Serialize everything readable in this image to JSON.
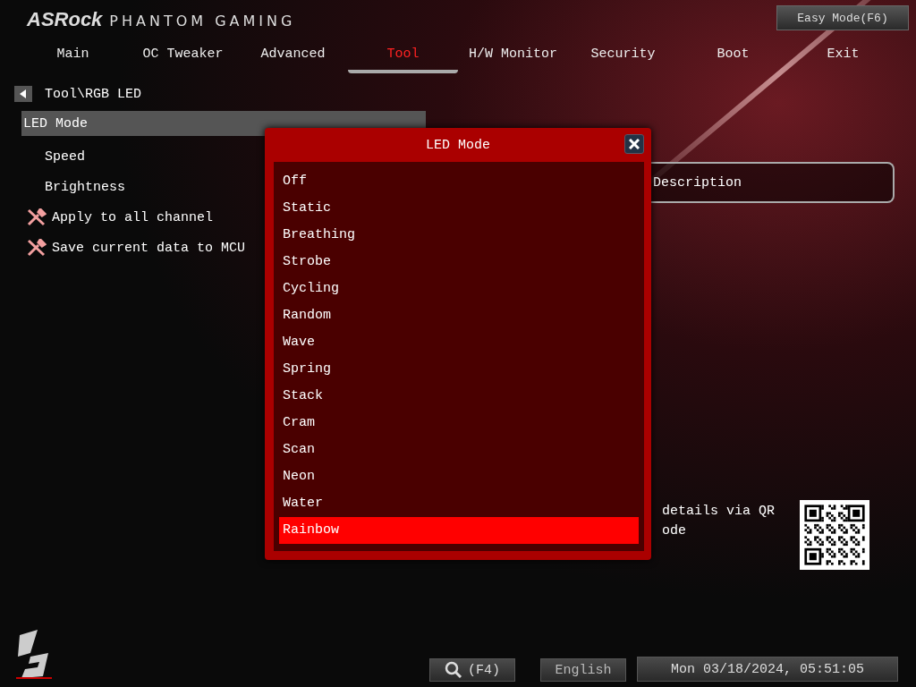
{
  "header": {
    "brand": "ASRock",
    "product": "PHANTOM GAMING",
    "easy_mode_button": "Easy Mode(F6)"
  },
  "tabs": [
    {
      "label": "Main",
      "selected": false
    },
    {
      "label": "OC Tweaker",
      "selected": false
    },
    {
      "label": "Advanced",
      "selected": false
    },
    {
      "label": "Tool",
      "selected": true
    },
    {
      "label": "H/W Monitor",
      "selected": false
    },
    {
      "label": "Security",
      "selected": false
    },
    {
      "label": "Boot",
      "selected": false
    },
    {
      "label": "Exit",
      "selected": false
    }
  ],
  "breadcrumb": "Tool\\RGB LED",
  "menu": [
    {
      "label": "LED Mode",
      "kind": "setting",
      "selected": true
    },
    {
      "label": "Speed",
      "kind": "setting",
      "selected": false
    },
    {
      "label": "Brightness",
      "kind": "setting",
      "selected": false
    },
    {
      "label": "Apply to all channel",
      "kind": "action",
      "selected": false
    },
    {
      "label": "Save current data to MCU",
      "kind": "action",
      "selected": false
    }
  ],
  "description": {
    "title": "Description",
    "qr_lines": [
      "details via QR",
      "ode"
    ]
  },
  "popup": {
    "title": "LED Mode",
    "options": [
      {
        "label": "Off",
        "selected": false
      },
      {
        "label": "Static",
        "selected": false
      },
      {
        "label": "Breathing",
        "selected": false
      },
      {
        "label": "Strobe",
        "selected": false
      },
      {
        "label": "Cycling",
        "selected": false
      },
      {
        "label": "Random",
        "selected": false
      },
      {
        "label": "Wave",
        "selected": false
      },
      {
        "label": "Spring",
        "selected": false
      },
      {
        "label": "Stack",
        "selected": false
      },
      {
        "label": "Cram",
        "selected": false
      },
      {
        "label": "Scan",
        "selected": false
      },
      {
        "label": "Neon",
        "selected": false
      },
      {
        "label": "Water",
        "selected": false
      },
      {
        "label": "Rainbow",
        "selected": true
      }
    ]
  },
  "status_bar": {
    "search_button": "(F4)",
    "language": "English",
    "datetime": "Mon 03/18/2024, 05:51:05"
  }
}
